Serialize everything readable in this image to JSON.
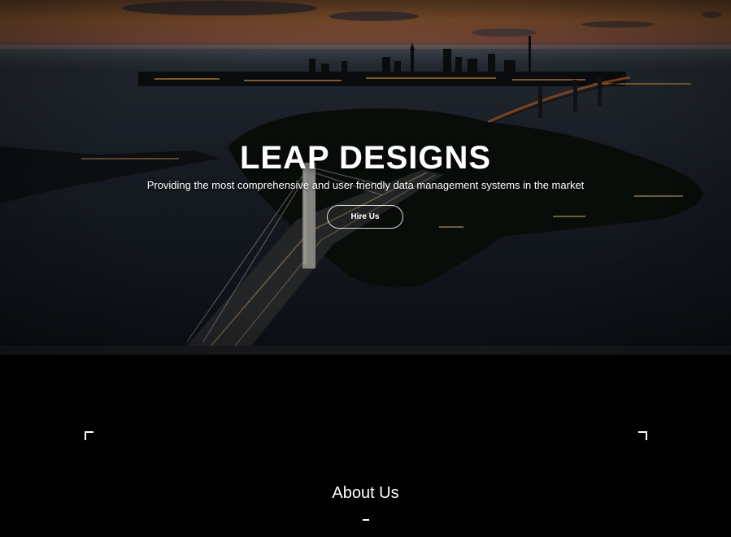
{
  "hero": {
    "title": "LEAP DESIGNS",
    "subtitle": "Providing the most comprehensive and user friendly data management systems in the market",
    "cta_label": "Hire Us"
  },
  "about": {
    "title": "About Us"
  },
  "colors": {
    "hero_text": "#ffffff",
    "section_background": "#000000",
    "sky_sunset": "#d98a4a",
    "water": "#1c2431"
  },
  "icons": {
    "corner_left": "corner-bracket-top-left-icon",
    "corner_right": "corner-bracket-top-right-icon"
  }
}
